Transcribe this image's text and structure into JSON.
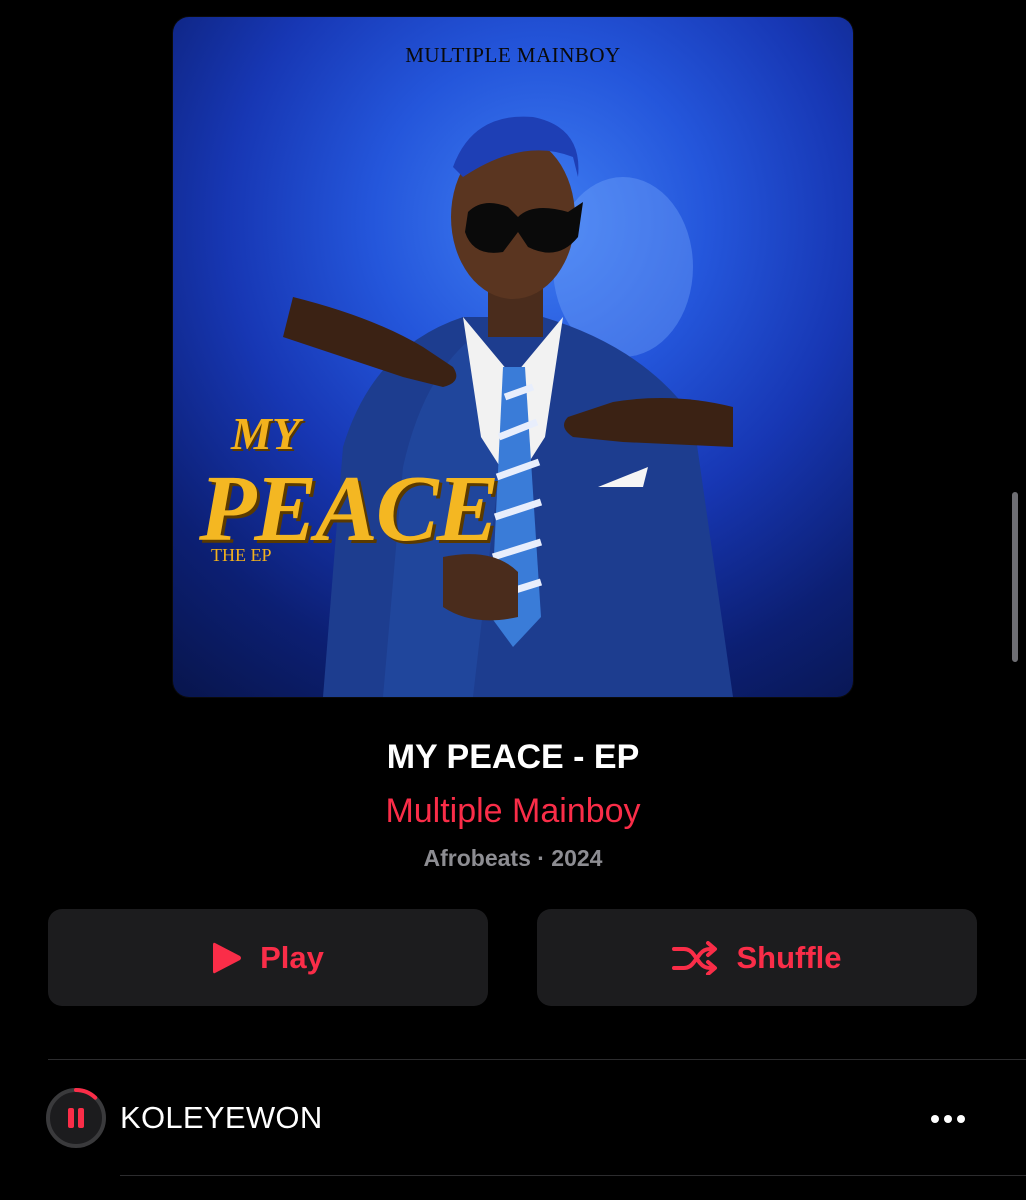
{
  "artwork": {
    "artist_text": "MULTIPLE MAINBOY",
    "title_my": "MY",
    "title_peace": "PEACE",
    "title_sub": "THE EP"
  },
  "album": {
    "title": "MY PEACE - EP",
    "artist": "Multiple Mainboy",
    "meta": "Afrobeats · 2024"
  },
  "actions": {
    "play_label": "Play",
    "play_icon": "play-icon",
    "shuffle_label": "Shuffle",
    "shuffle_icon": "shuffle-icon"
  },
  "tracks": [
    {
      "title": "KOLEYEWON",
      "state": "playing",
      "progress": 0.12,
      "more_icon": "ellipsis-icon"
    }
  ],
  "colors": {
    "accent": "#fa2d48",
    "background": "#000000",
    "button_bg": "#1c1c1e",
    "meta_text": "#8d8d92",
    "art_gold": "#f4b722",
    "art_blue": "#2456db"
  }
}
